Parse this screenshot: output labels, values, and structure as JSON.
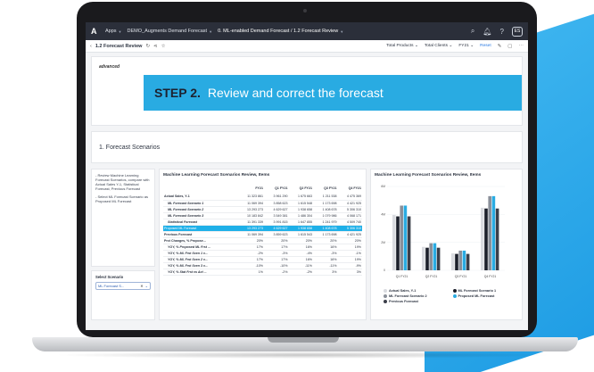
{
  "app": {
    "logo": "A",
    "breadcrumbs": [
      {
        "label": "Apps"
      },
      {
        "label": "DEMO_Augments Demand Forecast"
      },
      {
        "label": "0. ML-enabled Demand Forecast / 1.2 Forecast Review"
      }
    ],
    "avatar": "ES"
  },
  "subbar": {
    "back": "‹",
    "title": "1.2 Forecast Review",
    "filters": [
      "Total Products ⌄",
      "Total Clients ⌄",
      "FY21 ⌄"
    ],
    "reset": "Reset"
  },
  "banner": {
    "logo": "advanced",
    "step": "STEP 2.",
    "text": "Review and correct the forecast"
  },
  "section": {
    "number": "1.",
    "title": "Forecast Scenarios"
  },
  "notes": {
    "first": "- Review Machine Learning Forecast Scenarios, compare with Actual Sales Y-1, Statistical Forecast, Previous Forecast",
    "second": "- Select ML Forecast Scenario as Proposed ML Forecast"
  },
  "scenario_select": {
    "label": "Select Scenario",
    "value": "ML Forecast S..."
  },
  "table": {
    "title": "Machine Learning Forecast Scenarios Review, Items",
    "headers": [
      "",
      "FY21",
      "Q1 FY21",
      "Q2 FY21",
      "Q3 FY21",
      "Q4 FY21"
    ],
    "rows": [
      {
        "style": "bold",
        "cells": [
          "Actual Sales, Y-1",
          "11 323 861",
          "3 961 290",
          "1 675 663",
          "1 211 538",
          "4 475 369"
        ]
      },
      {
        "style": "indent",
        "cells": [
          "ML Forecast Scenario 1",
          "11 069 394",
          "3 858 623",
          "1 615 548",
          "1 173 698",
          "4 421 925"
        ]
      },
      {
        "style": "indent",
        "cells": [
          "ML Forecast Scenario 2",
          "13 293 273",
          "4 629 627",
          "1 938 658",
          "1 408 678",
          "5 306 310"
        ]
      },
      {
        "style": "indent",
        "cells": [
          "ML Forecast Scenario 3",
          "10 183 842",
          "3 549 381",
          "1 486 304",
          "1 079 986",
          "4 068 171"
        ]
      },
      {
        "style": "indent",
        "cells": [
          "Statistical Forecast",
          "11 391 339",
          "3 991 815",
          "1 647 855",
          "1 241 979",
          "4 509 740"
        ]
      },
      {
        "style": "hl",
        "cells": [
          "Proposed ML Forecast",
          "13 293 273",
          "4 629 627",
          "1 938 658",
          "1 408 678",
          "5 306 310"
        ]
      },
      {
        "style": "bold",
        "cells": [
          "Previous Forecast",
          "11 069 394",
          "3 859 623",
          "1 615 543",
          "1 173 698",
          "4 421 925"
        ]
      },
      {
        "style": "bold",
        "cells": [
          "Prct Changes, % Propose...",
          "20%",
          "20%",
          "20%",
          "20%",
          "20%"
        ]
      },
      {
        "style": "indent",
        "cells": [
          "YOY, % Proposed ML Frst ...",
          "17%",
          "17%",
          "16%",
          "16%",
          "19%"
        ]
      },
      {
        "style": "indent",
        "cells": [
          "YOY, % ML Frst Scen 1 v...",
          "-2%",
          "-3%",
          "-4%",
          "-3%",
          "-1%"
        ]
      },
      {
        "style": "indent",
        "cells": [
          "YOY, % ML Frst Scen 2 v...",
          "17%",
          "17%",
          "16%",
          "16%",
          "19%"
        ]
      },
      {
        "style": "indent",
        "cells": [
          "YOY, % ML Frst Scen 3 v...",
          "-10%",
          "-10%",
          "-11%",
          "-11%",
          "-9%"
        ]
      },
      {
        "style": "indent",
        "cells": [
          "YOY, % Stat Frst vs Act ...",
          "1%",
          "-2%",
          "-2%",
          "3%",
          "3%"
        ]
      }
    ]
  },
  "chart_data": {
    "type": "bar",
    "title": "Machine Learning Forecast Scenarios Review, Items",
    "categories": [
      "Q1 FY21",
      "Q2 FY21",
      "Q3 FY21",
      "Q4 FY21"
    ],
    "yticks": [
      "0",
      "2M",
      "4M",
      "6M"
    ],
    "ylim": [
      0,
      6000000
    ],
    "series": [
      {
        "name": "Actual Sales, Y-1",
        "color": "#d9dbe0",
        "values": [
          3961290,
          1675663,
          1211538,
          4475369
        ]
      },
      {
        "name": "ML Forecast Scenario 1",
        "color": "#1b1f2a",
        "values": [
          3858623,
          1615548,
          1173698,
          4421925
        ]
      },
      {
        "name": "ML Forecast Scenario 2",
        "color": "#8a8f99",
        "values": [
          4629627,
          1938658,
          1408678,
          5306310
        ]
      },
      {
        "name": "Proposed ML Forecast",
        "color": "#29abe2",
        "values": [
          4629627,
          1938658,
          1408678,
          5306310
        ]
      },
      {
        "name": "Previous Forecast",
        "color": "#3b3f4a",
        "values": [
          3859623,
          1615543,
          1173698,
          4421925
        ]
      }
    ],
    "legend": "bottom"
  }
}
